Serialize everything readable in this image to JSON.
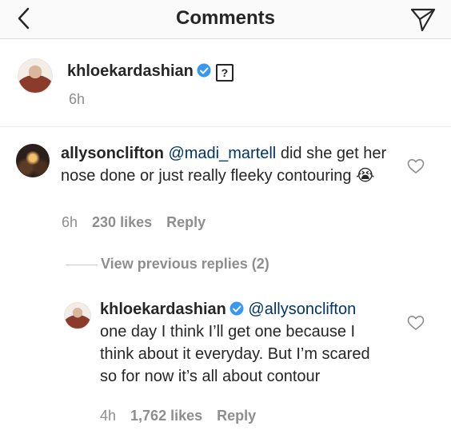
{
  "header": {
    "title": "Comments",
    "back_icon": "chevron-left-icon",
    "share_icon": "paper-plane-icon"
  },
  "post_caption": {
    "username": "khloekardashian",
    "verified": true,
    "question_glyph": "?",
    "time": "6h"
  },
  "comment": {
    "username": "allysonclifton",
    "mention": "@madi_martell",
    "text": "did she get her nose done or just really fleeky contouring 😭",
    "time": "6h",
    "likes": "230 likes",
    "reply_label": "Reply"
  },
  "view_previous_replies": "View previous replies (2)",
  "reply": {
    "username": "khloekardashian",
    "verified": true,
    "mention": "@allysonclifton",
    "text": "one day I think I’ll get one because I think about it everyday. But I’m scared so for now it’s all about contour",
    "time": "4h",
    "likes": "1,762 likes",
    "reply_label": "Reply"
  },
  "colors": {
    "verified_blue": "#3897f0",
    "mention_blue": "#003569",
    "meta_gray": "#8e8e8e"
  }
}
